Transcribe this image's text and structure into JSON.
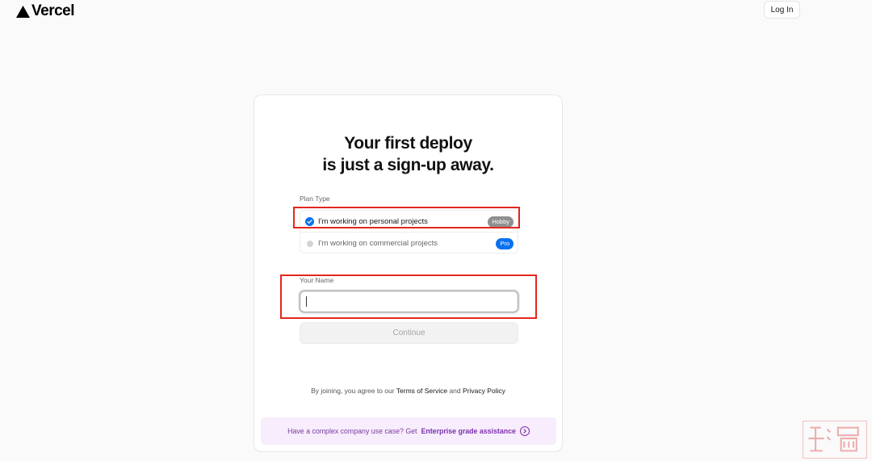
{
  "header": {
    "logo_text": "Vercel",
    "login_label": "Log In"
  },
  "card": {
    "title_line1": "Your first deploy",
    "title_line2": "is just a sign-up away.",
    "plan_label": "Plan Type",
    "plans": [
      {
        "text": "I'm working on personal projects",
        "badge": "Hobby",
        "selected": true
      },
      {
        "text": "I'm working on commercial projects",
        "badge": "Pro",
        "selected": false
      }
    ],
    "name_label": "Your Name",
    "name_value": "",
    "continue_label": "Continue",
    "terms": {
      "prefix": "By joining, you agree to our",
      "tos": "Terms of Service",
      "and": "and",
      "privacy": "Privacy Policy"
    },
    "enterprise": {
      "prefix": "Have a complex company use case? Get",
      "link": "Enterprise grade assistance"
    }
  },
  "icons": {
    "logo": "vercel-triangle-icon",
    "selected_radio": "check-circle-icon",
    "enterprise_arrow": "arrow-right-circle-icon"
  },
  "colors": {
    "accent": "#0a72ef",
    "highlight": "#e5261e",
    "enterprise_bg": "#f7edfc",
    "enterprise_text": "#7a2fae"
  }
}
